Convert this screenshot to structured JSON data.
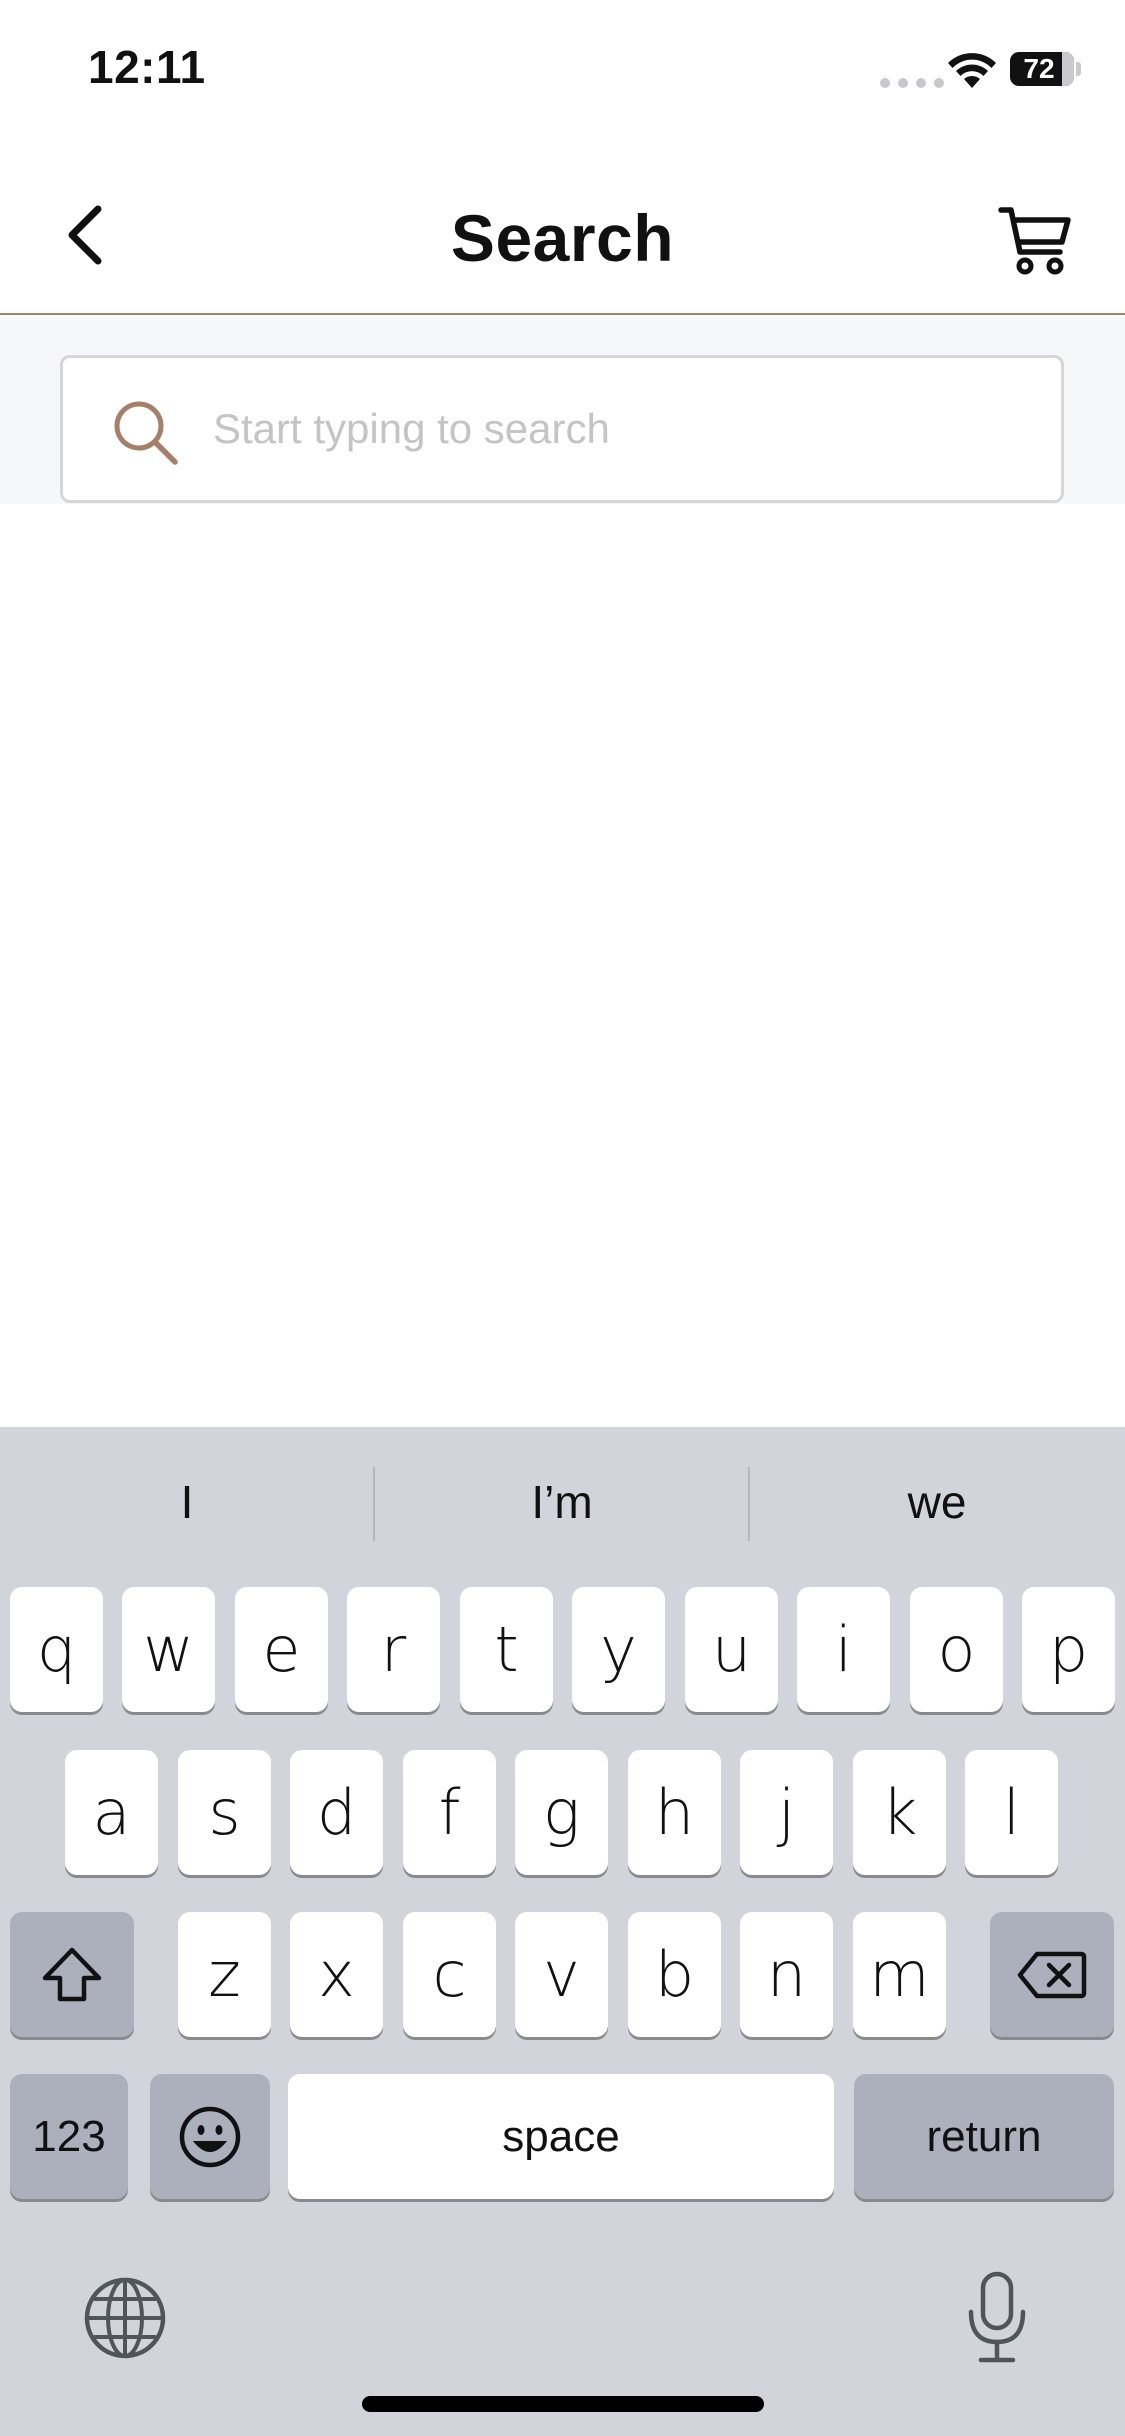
{
  "status_bar": {
    "time": "12:11",
    "battery": "72"
  },
  "nav": {
    "title": "Search",
    "accent_color": "#a67f69"
  },
  "search": {
    "placeholder": "Start typing to search",
    "value": ""
  },
  "keyboard": {
    "suggestions": [
      "I",
      "I’m",
      "we"
    ],
    "row1": [
      "q",
      "w",
      "e",
      "r",
      "t",
      "y",
      "u",
      "i",
      "o",
      "p"
    ],
    "row2": [
      "a",
      "s",
      "d",
      "f",
      "g",
      "h",
      "j",
      "k",
      "l"
    ],
    "row3": [
      "z",
      "x",
      "c",
      "v",
      "b",
      "n",
      "m"
    ],
    "numbers_label": "123",
    "space_label": "space",
    "return_label": "return"
  },
  "icons": {
    "back": "chevron-left-icon",
    "cart": "cart-icon",
    "search": "search-icon",
    "shift": "shift-icon",
    "delete": "delete-icon",
    "emoji": "emoji-icon",
    "globe": "globe-icon",
    "mic": "mic-icon"
  }
}
